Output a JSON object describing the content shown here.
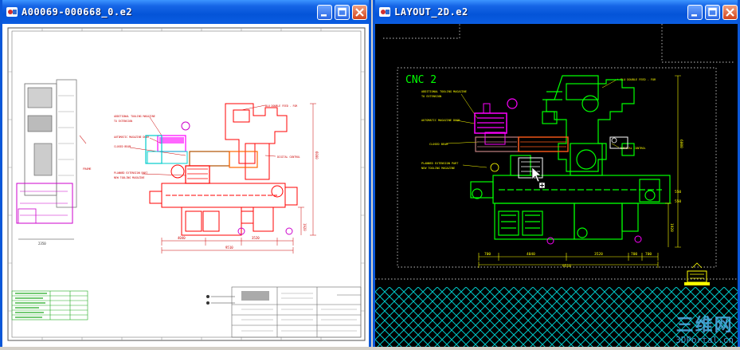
{
  "left_window": {
    "title": "A00069-000668_0.e2"
  },
  "right_window": {
    "title": "LAYOUT_2D.e2",
    "drawing_label": "CNC 2"
  },
  "watermark": {
    "cn": "三维网",
    "en": "3DPortal.cn"
  },
  "colors": {
    "titlebar": "#0454d8",
    "cad_background": "#000000",
    "green": "#00ff00",
    "red": "#ff0000",
    "magenta": "#ff00ff",
    "cyan": "#00ffff",
    "hatch": "#00c8c8"
  }
}
